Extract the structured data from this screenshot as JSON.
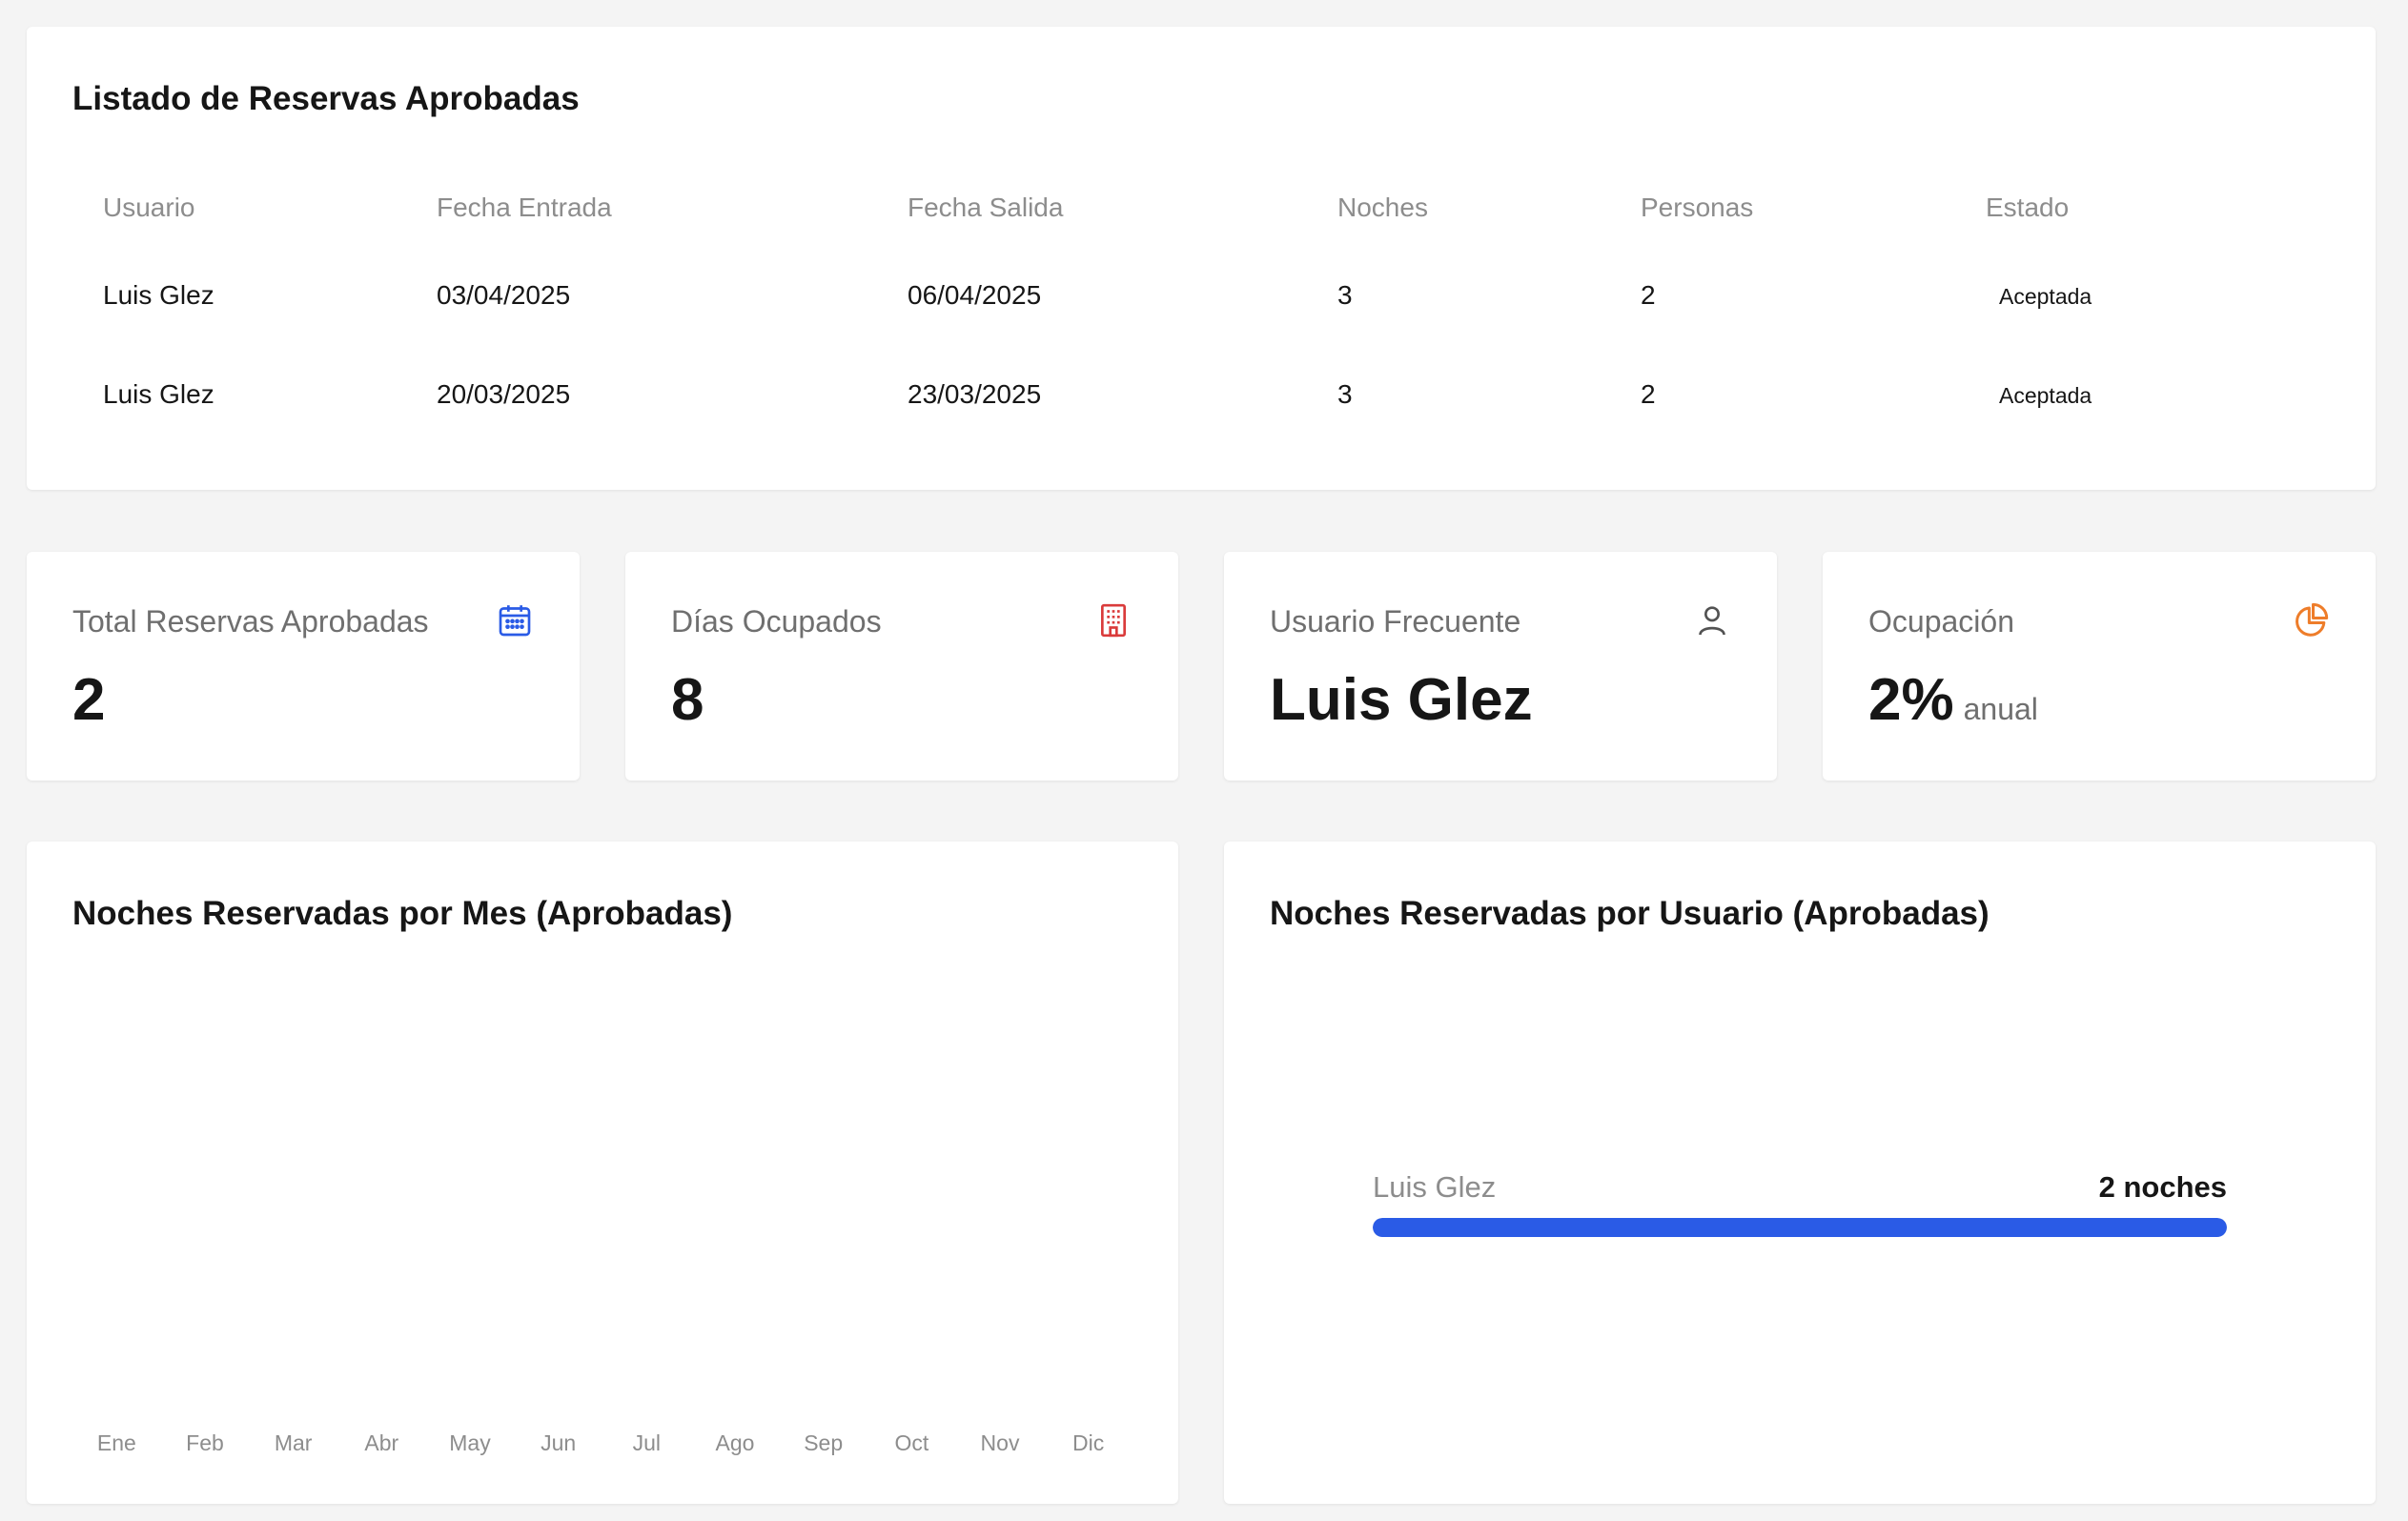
{
  "reservations": {
    "title": "Listado de Reservas Aprobadas",
    "columns": [
      "Usuario",
      "Fecha Entrada",
      "Fecha Salida",
      "Noches",
      "Personas",
      "Estado"
    ],
    "rows": [
      [
        "Luis Glez",
        "03/04/2025",
        "06/04/2025",
        "3",
        "2",
        "Aceptada"
      ],
      [
        "Luis Glez",
        "20/03/2025",
        "23/03/2025",
        "3",
        "2",
        "Aceptada"
      ]
    ]
  },
  "stats": [
    {
      "label": "Total Reservas Aprobadas",
      "value": "2",
      "suffix": "",
      "icon": "calendar-icon",
      "color": "#2a5be6"
    },
    {
      "label": "Días Ocupados",
      "value": "8",
      "suffix": "",
      "icon": "building-icon",
      "color": "#da3b3b"
    },
    {
      "label": "Usuario Frecuente",
      "value": "Luis Glez",
      "suffix": "",
      "icon": "user-icon",
      "color": "#525252"
    },
    {
      "label": "Ocupación",
      "value": "2%",
      "suffix": "anual",
      "icon": "pie-chart-icon",
      "color": "#ee7d2a"
    }
  ],
  "chart_data": [
    {
      "type": "bar",
      "title": "Noches Reservadas por Mes (Aprobadas)",
      "categories": [
        "Ene",
        "Feb",
        "Mar",
        "Abr",
        "May",
        "Jun",
        "Jul",
        "Ago",
        "Sep",
        "Oct",
        "Nov",
        "Dic"
      ],
      "values": [
        0,
        0,
        0,
        0,
        0,
        0,
        0,
        0,
        0,
        0,
        0,
        0
      ]
    },
    {
      "type": "bar",
      "title": "Noches Reservadas por Usuario (Aprobadas)",
      "categories": [
        "Luis Glez"
      ],
      "values": [
        2
      ],
      "value_labels": [
        "2 noches"
      ],
      "fill_fraction": [
        1.0
      ],
      "color": "#2a5be6"
    }
  ]
}
